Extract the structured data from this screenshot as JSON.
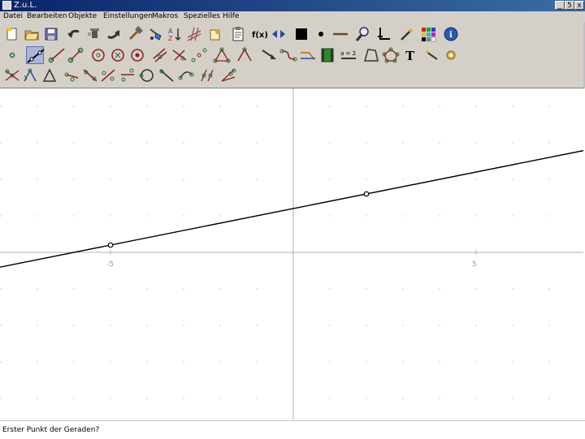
{
  "window": {
    "title": "Z.u.L.",
    "minimize": "_",
    "maximize": "5",
    "close": "x"
  },
  "menu": [
    "Datei",
    "Bearbeiten",
    "Objekte",
    "Einstellungen",
    "Makros",
    "Spezielles",
    "Hilfe"
  ],
  "toolbar": {
    "rows": [
      [
        "new-icon",
        "open-icon",
        "save-icon",
        "undo-icon",
        "delete-icon",
        "redo-icon",
        "hammer-icon",
        "paint-icon",
        "sort-icon",
        "grid-icon",
        "copy-icon",
        "clipboard-icon",
        "function-icon",
        "arrows-icon",
        "black-square-icon",
        "dot-icon",
        "line-segment-icon",
        "zoom-icon",
        "axes-icon",
        "wand-icon",
        "palette-icon",
        "info-icon"
      ],
      [
        "point-icon",
        "line-icon",
        "ray-icon",
        "segment-icon",
        "circle-icon",
        "circle-fixed-icon",
        "circle-three-icon",
        "parallel-icon",
        "perpendicular-icon",
        "midpoint-icon",
        "triangle-icon",
        "angle-icon",
        "move-icon",
        "curve-icon",
        "bezier-icon",
        "film-icon",
        "expression-icon",
        "polygon-icon",
        "polygon-edit-icon",
        "text-icon",
        "tool-wand-icon",
        "settings-icon"
      ],
      [
        "intersection-icon",
        "reflection-icon",
        "triangle-outline-icon",
        "pointset-icon",
        "tangent-icon",
        "chain-icon",
        "circle-chain-icon",
        "diagonal-icon",
        "circle-point-icon",
        "polyline-icon",
        "pair-icon",
        "angle-bisector-icon"
      ]
    ],
    "function_label": "f(x)",
    "expression_label": "a = 2",
    "text_label": "T"
  },
  "chart_data": {
    "type": "line",
    "xlim": [
      -8,
      8
    ],
    "ylim": [
      -4.5,
      4.5
    ],
    "grid": true,
    "xticks": [
      {
        "value": -5,
        "label": "-5"
      },
      {
        "value": 5,
        "label": "5"
      }
    ],
    "line": {
      "slope": 0.2,
      "intercept": 1.2
    },
    "points": [
      {
        "x": -5,
        "y": 0.2
      },
      {
        "x": 2,
        "y": 1.6
      }
    ]
  },
  "status": {
    "prompt": "Erster Punkt der Geraden?"
  }
}
